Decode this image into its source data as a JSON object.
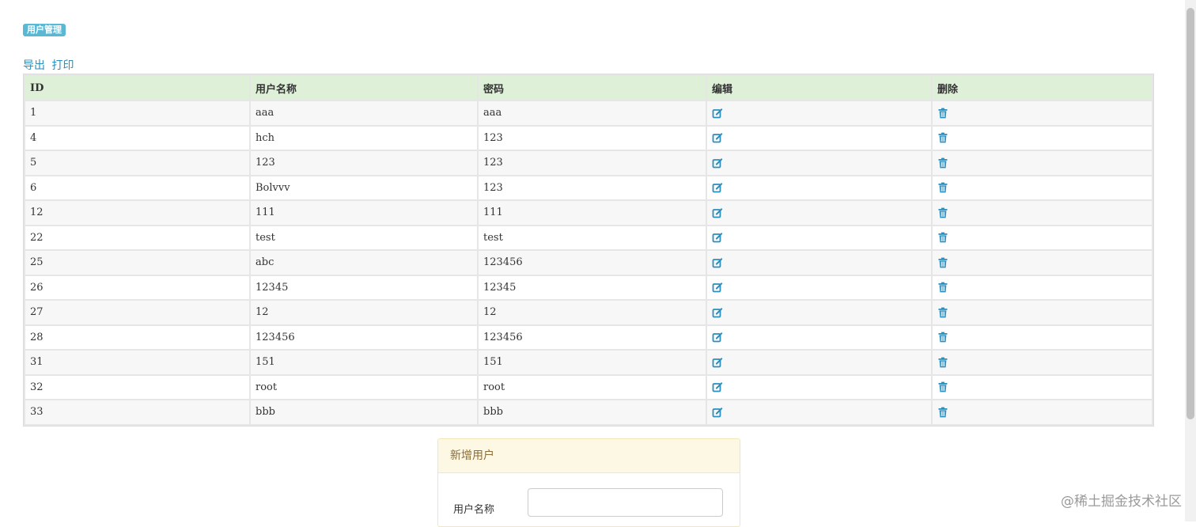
{
  "header": {
    "badge": "用户管理"
  },
  "toolbar": {
    "export_label": "导出",
    "print_label": "打印"
  },
  "table": {
    "headers": [
      "ID",
      "用户名称",
      "密码",
      "编辑",
      "删除"
    ],
    "rows": [
      {
        "id": "1",
        "name": "aaa",
        "password": "aaa"
      },
      {
        "id": "4",
        "name": "hch",
        "password": "123"
      },
      {
        "id": "5",
        "name": "123",
        "password": "123"
      },
      {
        "id": "6",
        "name": "Bolvvv",
        "password": "123"
      },
      {
        "id": "12",
        "name": "111",
        "password": "111"
      },
      {
        "id": "22",
        "name": "test",
        "password": "test"
      },
      {
        "id": "25",
        "name": "abc",
        "password": "123456"
      },
      {
        "id": "26",
        "name": "12345",
        "password": "12345"
      },
      {
        "id": "27",
        "name": "12",
        "password": "12"
      },
      {
        "id": "28",
        "name": "123456",
        "password": "123456"
      },
      {
        "id": "31",
        "name": "151",
        "password": "151"
      },
      {
        "id": "32",
        "name": "root",
        "password": "root"
      },
      {
        "id": "33",
        "name": "bbb",
        "password": "bbb"
      }
    ],
    "edit_icon": "edit-icon",
    "delete_icon": "trash-icon",
    "accent_color": "#2a8fbd",
    "header_bg": "#dff0d8"
  },
  "add_user_panel": {
    "title": "新增用户",
    "username_label": "用户名称",
    "username_value": ""
  },
  "watermark": "@稀土掘金技术社区"
}
